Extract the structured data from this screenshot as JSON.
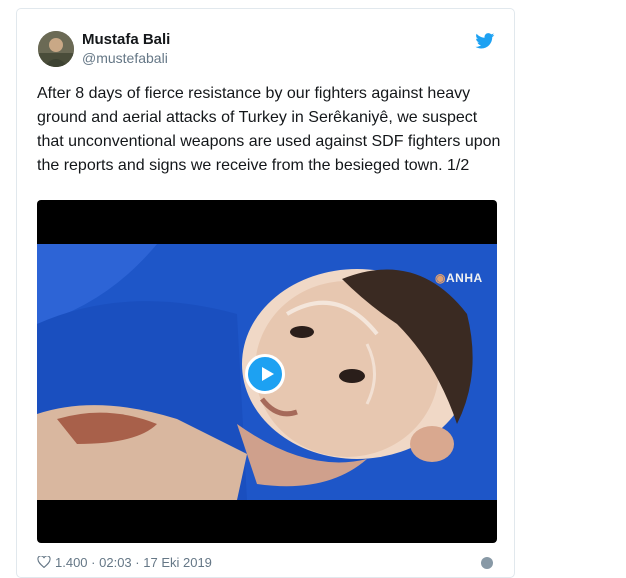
{
  "tweet": {
    "author_name": "Mustafa Bali",
    "author_handle": "@mustefabali",
    "text": "After 8 days of fierce resistance by our fighters against heavy ground and aerial attacks of Turkey in Serêkaniyê, we suspect that unconventional weapons are used against SDF fighters upon the reports and signs we receive from the besieged town. 1/2",
    "media": {
      "watermark": "ANHA",
      "play_icon": "play-icon"
    },
    "footer": {
      "likes": "1.400",
      "time": "02:03",
      "date": "17 Eki 2019"
    }
  },
  "colors": {
    "twitter_blue": "#1da1f2",
    "text": "#14171a",
    "muted": "#657786"
  }
}
